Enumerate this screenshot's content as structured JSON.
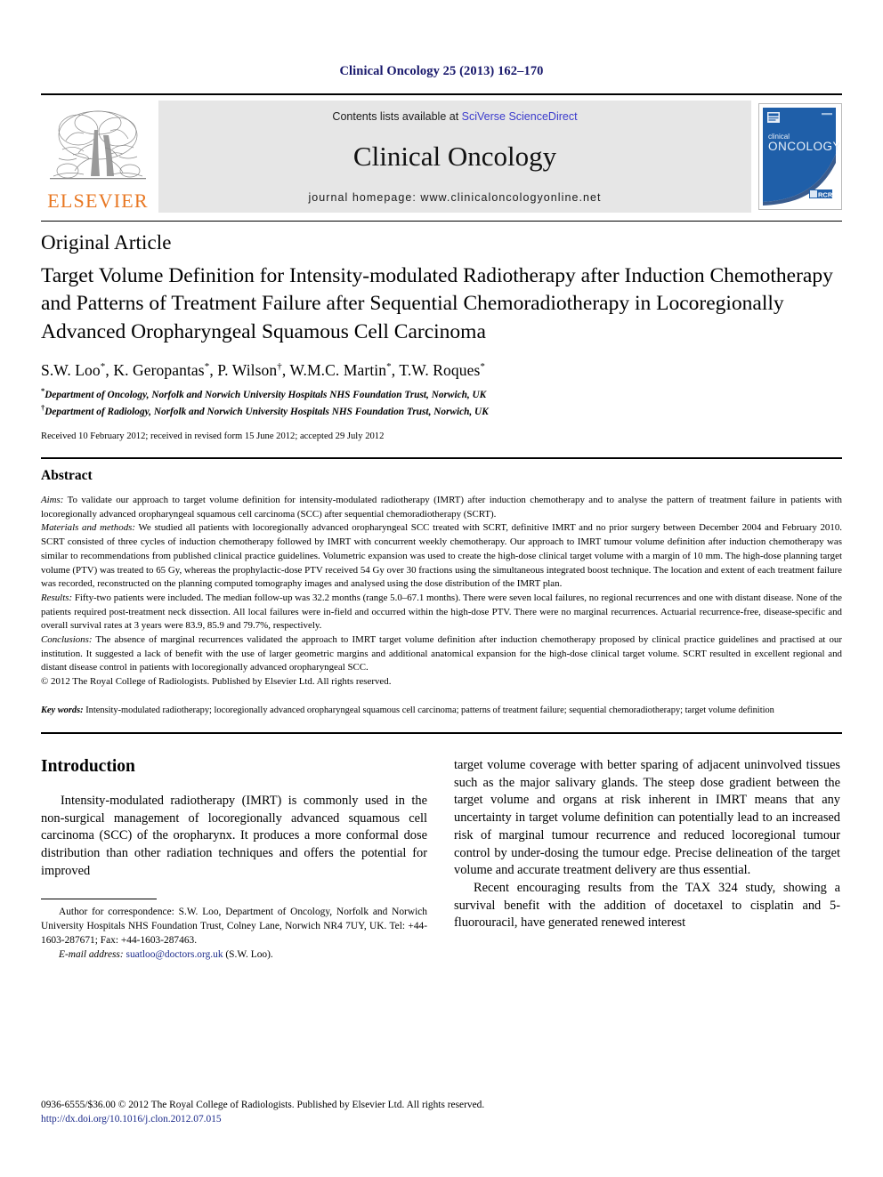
{
  "running_head": "Clinical Oncology 25 (2013) 162–170",
  "banner": {
    "publisher_logo_label": "ELSEVIER",
    "contents_prefix": "Contents lists available at ",
    "contents_link": "SciVerse ScienceDirect",
    "journal_name": "Clinical Oncology",
    "homepage_label": "journal homepage: www.clinicaloncologyonline.net",
    "cover_title_small": "clinical",
    "cover_title_large": "ONCOLOGY",
    "cover_badge": "RCR"
  },
  "article": {
    "type": "Original Article",
    "title": "Target Volume Definition for Intensity-modulated Radiotherapy after Induction Chemotherapy and Patterns of Treatment Failure after Sequential Chemoradiotherapy in Locoregionally Advanced Oropharyngeal Squamous Cell Carcinoma",
    "authors_html": "S.W. Loo *, K. Geropantas *, P. Wilson †, W.M.C. Martin *, T.W. Roques *",
    "authors": [
      {
        "name": "S.W. Loo",
        "mark": "*"
      },
      {
        "name": "K. Geropantas",
        "mark": "*"
      },
      {
        "name": "P. Wilson",
        "mark": "†"
      },
      {
        "name": "W.M.C. Martin",
        "mark": "*"
      },
      {
        "name": "T.W. Roques",
        "mark": "*"
      }
    ],
    "affiliations": [
      {
        "mark": "*",
        "text": "Department of Oncology, Norfolk and Norwich University Hospitals NHS Foundation Trust, Norwich, UK"
      },
      {
        "mark": "†",
        "text": "Department of Radiology, Norfolk and Norwich University Hospitals NHS Foundation Trust, Norwich, UK"
      }
    ],
    "history": "Received 10 February 2012; received in revised form 15 June 2012; accepted 29 July 2012"
  },
  "abstract": {
    "heading": "Abstract",
    "sections": [
      {
        "label": "Aims:",
        "text": " To validate our approach to target volume definition for intensity-modulated radiotherapy (IMRT) after induction chemotherapy and to analyse the pattern of treatment failure in patients with locoregionally advanced oropharyngeal squamous cell carcinoma (SCC) after sequential chemoradiotherapy (SCRT)."
      },
      {
        "label": "Materials and methods:",
        "text": " We studied all patients with locoregionally advanced oropharyngeal SCC treated with SCRT, definitive IMRT and no prior surgery between December 2004 and February 2010. SCRT consisted of three cycles of induction chemotherapy followed by IMRT with concurrent weekly chemotherapy. Our approach to IMRT tumour volume definition after induction chemotherapy was similar to recommendations from published clinical practice guidelines. Volumetric expansion was used to create the high-dose clinical target volume with a margin of 10 mm. The high-dose planning target volume (PTV) was treated to 65 Gy, whereas the prophylactic-dose PTV received 54 Gy over 30 fractions using the simultaneous integrated boost technique. The location and extent of each treatment failure was recorded, reconstructed on the planning computed tomography images and analysed using the dose distribution of the IMRT plan."
      },
      {
        "label": "Results:",
        "text": " Fifty-two patients were included. The median follow-up was 32.2 months (range 5.0–67.1 months). There were seven local failures, no regional recurrences and one with distant disease. None of the patients required post-treatment neck dissection. All local failures were in-field and occurred within the high-dose PTV. There were no marginal recurrences. Actuarial recurrence-free, disease-specific and overall survival rates at 3 years were 83.9, 85.9 and 79.7%, respectively."
      },
      {
        "label": "Conclusions:",
        "text": " The absence of marginal recurrences validated the approach to IMRT target volume definition after induction chemotherapy proposed by clinical practice guidelines and practised at our institution. It suggested a lack of benefit with the use of larger geometric margins and additional anatomical expansion for the high-dose clinical target volume. SCRT resulted in excellent regional and distant disease control in patients with locoregionally advanced oropharyngeal SCC."
      }
    ],
    "copyright": "© 2012 The Royal College of Radiologists. Published by Elsevier Ltd. All rights reserved.",
    "keywords_label": "Key words:",
    "keywords_text": " Intensity-modulated radiotherapy; locoregionally advanced oropharyngeal squamous cell carcinoma; patterns of treatment failure; sequential chemoradiotherapy; target volume definition"
  },
  "body": {
    "intro_heading": "Introduction",
    "left_paragraph": "Intensity-modulated radiotherapy (IMRT) is commonly used in the non-surgical management of locoregionally advanced squamous cell carcinoma (SCC) of the oropharynx. It produces a more conformal dose distribution than other radiation techniques and offers the potential for improved",
    "right_paragraph_1": "target volume coverage with better sparing of adjacent uninvolved tissues such as the major salivary glands. The steep dose gradient between the target volume and organs at risk inherent in IMRT means that any uncertainty in target volume definition can potentially lead to an increased risk of marginal tumour recurrence and reduced locoregional tumour control by under-dosing the tumour edge. Precise delineation of the target volume and accurate treatment delivery are thus essential.",
    "right_paragraph_2": "Recent encouraging results from the TAX 324 study, showing a survival benefit with the addition of docetaxel to cisplatin and 5-fluorouracil, have generated renewed interest"
  },
  "footnote": {
    "correspondence": "Author for correspondence: S.W. Loo, Department of Oncology, Norfolk and Norwich University Hospitals NHS Foundation Trust, Colney Lane, Norwich NR4 7UY, UK. Tel: +44-1603-287671; Fax: +44-1603-287463.",
    "email_label": "E-mail address:",
    "email": "suatloo@doctors.org.uk",
    "email_suffix": " (S.W. Loo)."
  },
  "page_footer": {
    "issn_line": "0936-6555/$36.00 © 2012 The Royal College of Radiologists. Published by Elsevier Ltd. All rights reserved.",
    "doi": "http://dx.doi.org/10.1016/j.clon.2012.07.015"
  },
  "colors": {
    "running_head": "#17176b",
    "link": "#1b2a8a",
    "sciencedirect_link": "#3b3bcc",
    "elsevier_orange": "#e87722",
    "banner_grey": "#e6e6e6",
    "cover_blue": "#1f5fa9"
  }
}
